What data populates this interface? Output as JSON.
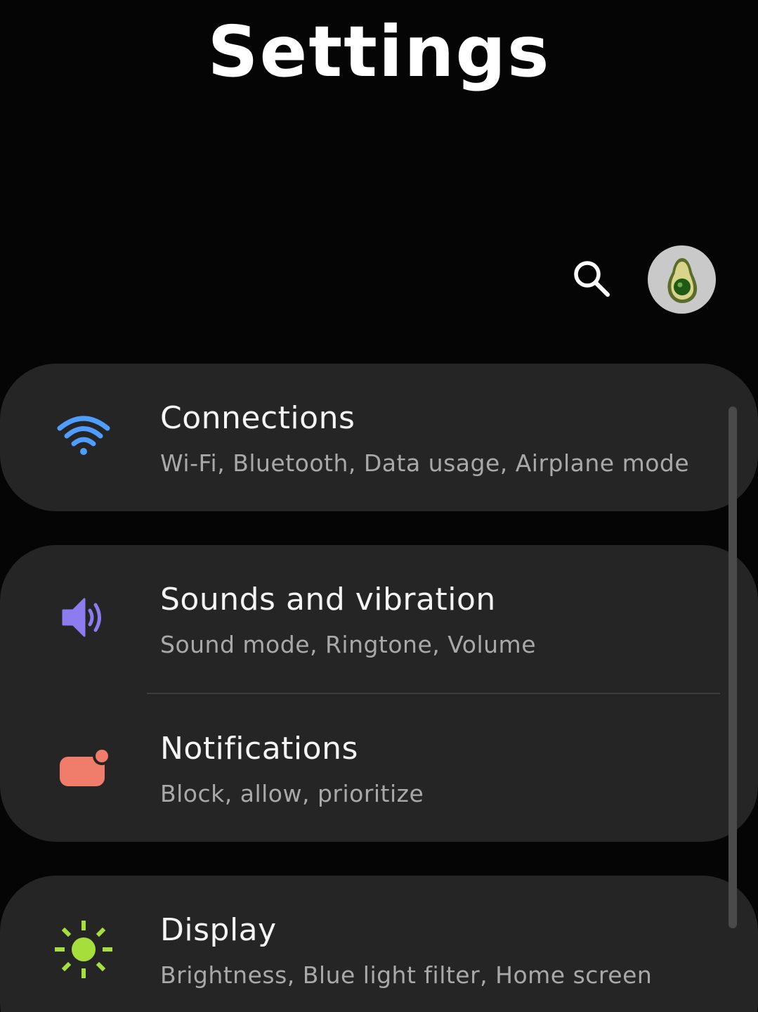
{
  "header": {
    "title": "Settings",
    "search_icon": "search-icon",
    "avatar_icon": "avocado-avatar"
  },
  "colors": {
    "background": "#050505",
    "card": "#252525",
    "wifi": "#4f9dff",
    "sound": "#8c7cf0",
    "notifications": "#f07c6c",
    "display": "#a6df3c"
  },
  "items": [
    {
      "title": "Connections",
      "subtitle": "Wi-Fi, Bluetooth, Data usage, Airplane mode",
      "icon": "wifi-icon"
    },
    {
      "title": "Sounds and vibration",
      "subtitle": "Sound mode, Ringtone, Volume",
      "icon": "speaker-icon"
    },
    {
      "title": "Notifications",
      "subtitle": "Block, allow, prioritize",
      "icon": "notification-badge-icon"
    },
    {
      "title": "Display",
      "subtitle": "Brightness, Blue light filter, Home screen",
      "icon": "sun-icon"
    }
  ]
}
